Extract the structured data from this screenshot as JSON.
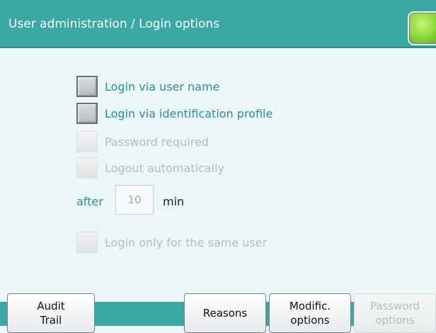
{
  "header": {
    "title": "User administration / Login options"
  },
  "options": [
    {
      "label": "Login via user name",
      "enabled": true,
      "checked": false
    },
    {
      "label": "Login via identification profile",
      "enabled": true,
      "checked": false
    },
    {
      "label": "Password required",
      "enabled": false,
      "checked": false
    },
    {
      "label": "Logout automatically",
      "enabled": false,
      "checked": false
    },
    {
      "label": "Login only for the same user",
      "enabled": false,
      "checked": false
    }
  ],
  "logout": {
    "after_label": "after",
    "minutes_value": "10",
    "unit_label": "min"
  },
  "footer": {
    "audit_trail_line1": "Audit",
    "audit_trail_line2": "Trail",
    "reasons": "Reasons",
    "modific_line1": "Modific.",
    "modific_line2": "options",
    "password_line1": "Password",
    "password_line2": "options"
  },
  "colors": {
    "titlebar": "#3aa9a4",
    "accent_text": "#2a8f94",
    "disabled_text": "#b6bcbe",
    "background": "#eaf6f8",
    "home_button": "#8fdc3c"
  },
  "icons": {
    "home": "home-icon"
  }
}
